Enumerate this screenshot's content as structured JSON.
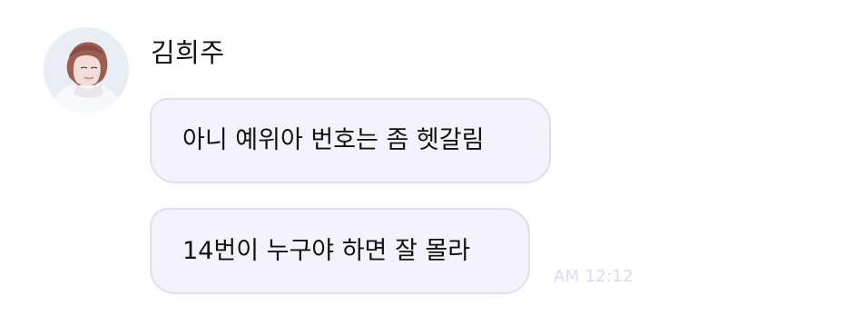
{
  "message_group": {
    "sender": {
      "name": "김희주",
      "avatar": "profile-photo"
    },
    "messages": [
      {
        "text": "아니 예위아 번호는 좀 헷갈림"
      },
      {
        "text": "14번이 누구야 하면 잘 몰라"
      }
    ],
    "timestamp": "AM 12:12"
  },
  "colors": {
    "bubble_background": "#f4f2fd",
    "bubble_border": "#e3dcf2",
    "timestamp_text": "#e2d6f5"
  }
}
